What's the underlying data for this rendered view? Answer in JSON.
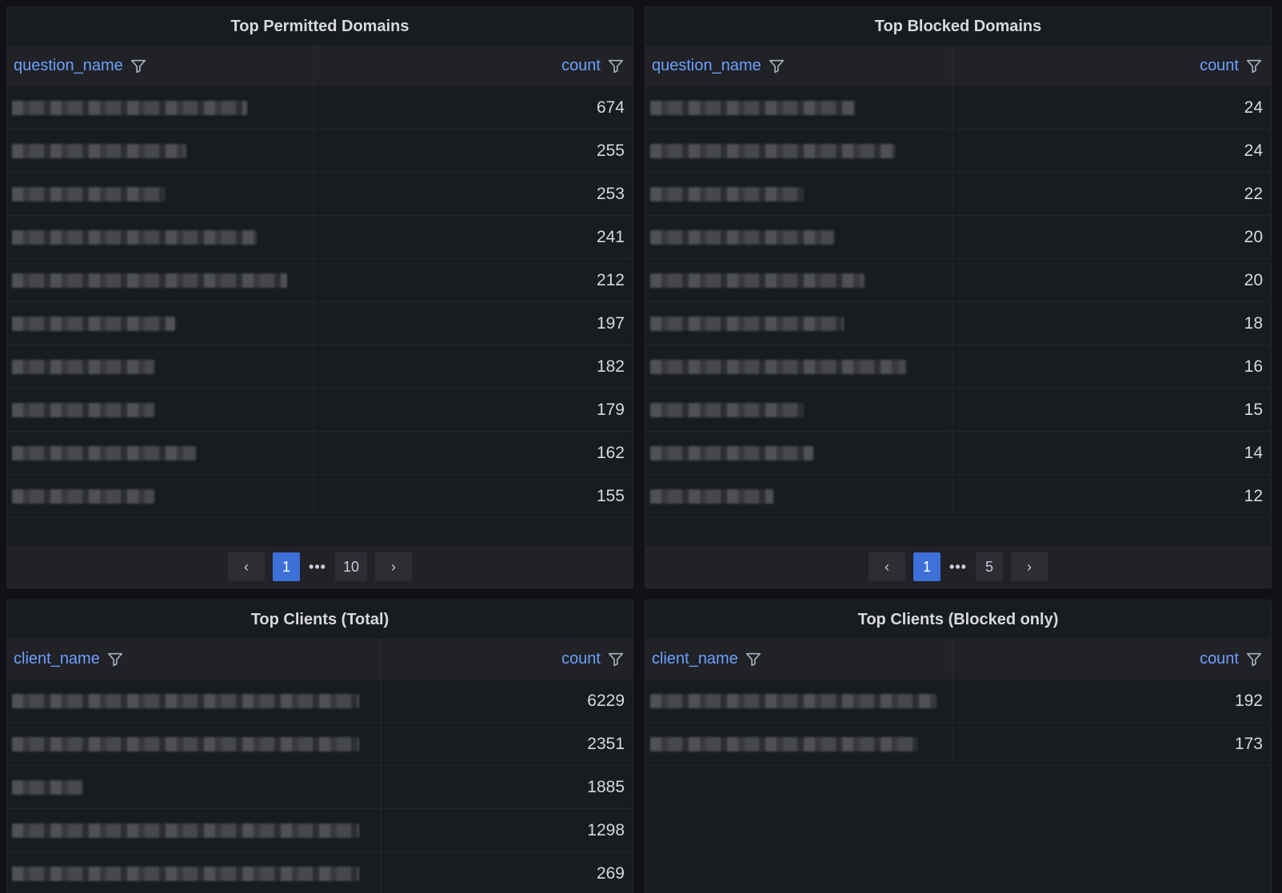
{
  "panels": {
    "permitted": {
      "title": "Top Permitted Domains",
      "name_header": "question_name",
      "count_header": "count",
      "counts": [
        "674",
        "255",
        "253",
        "241",
        "212",
        "197",
        "182",
        "179",
        "162",
        "155"
      ],
      "pager": {
        "prev": "‹",
        "current": "1",
        "ellipsis": "•••",
        "last": "10",
        "next": "›"
      }
    },
    "blocked": {
      "title": "Top Blocked Domains",
      "name_header": "question_name",
      "count_header": "count",
      "counts": [
        "24",
        "24",
        "22",
        "20",
        "20",
        "18",
        "16",
        "15",
        "14",
        "12"
      ],
      "pager": {
        "prev": "‹",
        "current": "1",
        "ellipsis": "•••",
        "last": "5",
        "next": "›"
      }
    },
    "clients_total": {
      "title": "Top Clients (Total)",
      "name_header": "client_name",
      "count_header": "count",
      "counts": [
        "6229",
        "2351",
        "1885",
        "1298",
        "269"
      ]
    },
    "clients_blocked": {
      "title": "Top Clients (Blocked only)",
      "name_header": "client_name",
      "count_header": "count",
      "counts": [
        "192",
        "173"
      ]
    }
  },
  "icons": {
    "filter": "filter-funnel-icon"
  },
  "colors": {
    "header_text": "#6e9fff",
    "active_page": "#3d71d9",
    "panel_bg": "#181b1f"
  }
}
